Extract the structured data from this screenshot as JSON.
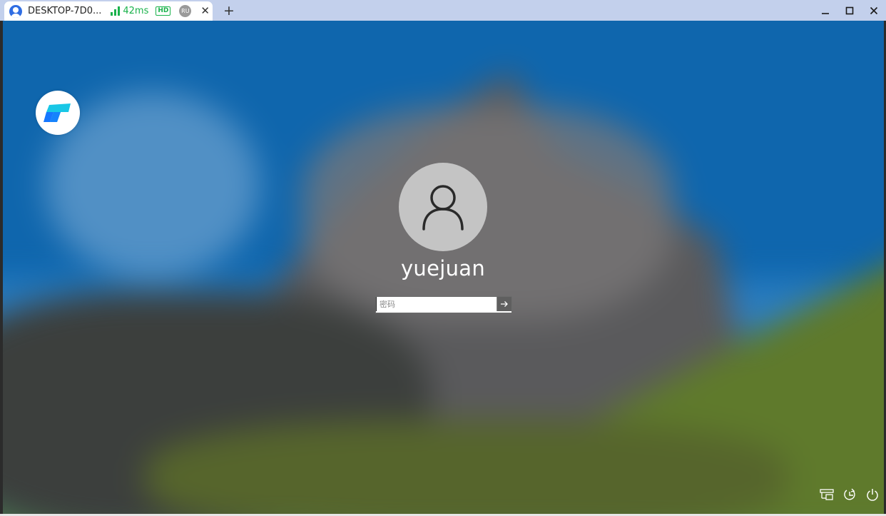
{
  "tab": {
    "title": "DESKTOP-7D0...",
    "latency": "42ms",
    "quality_badge": "HD",
    "language_badge": "RU",
    "close_symbol": "✕",
    "icons": [
      "user-avatar-icon",
      "signal-bars-icon",
      "close-icon"
    ]
  },
  "titlebar": {
    "new_tab_symbol": "+",
    "controls": [
      "minimize-icon",
      "maximize-icon",
      "close-icon"
    ]
  },
  "lockscreen": {
    "username": "yuejuan",
    "password_placeholder": "密码",
    "password_value": "",
    "submit_icon": "arrow-right-icon",
    "app_logo_icon": "todesk-logo-icon",
    "avatar_icon": "user-silhouette-icon",
    "tray_icons": [
      "network-icon",
      "ease-of-access-icon",
      "power-icon"
    ]
  },
  "colors": {
    "titlebar_bg": "#c3d0ec",
    "accent_green": "#19b24b",
    "logo_cyan": "#19c7e6",
    "logo_blue": "#1677ff",
    "avatar_bg": "#c4c4c4",
    "submit_bg": "#5f5f5f"
  }
}
